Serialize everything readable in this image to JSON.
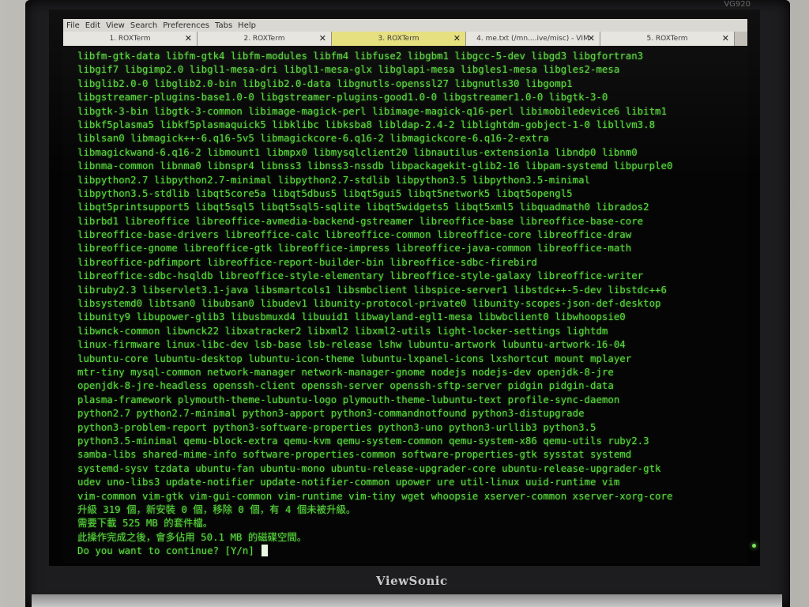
{
  "monitor": {
    "brand": "ViewSonic",
    "model": "VG920"
  },
  "menubar": [
    "File",
    "Edit",
    "View",
    "Search",
    "Preferences",
    "Tabs",
    "Help"
  ],
  "tabs": [
    {
      "label": "1. ROXTerm",
      "active": false
    },
    {
      "label": "2. ROXTerm",
      "active": false
    },
    {
      "label": "3. ROXTerm",
      "active": true
    },
    {
      "label": "4. me.txt (/mn....ive/misc) - VIM",
      "active": false
    },
    {
      "label": "5. ROXTerm",
      "active": false
    }
  ],
  "terminal": {
    "lines": [
      "libfm-gtk-data libfm-gtk4 libfm-modules libfm4 libfuse2 libgbm1 libgcc-5-dev libgd3 libgfortran3",
      "libgif7 libgimp2.0 libgl1-mesa-dri libgl1-mesa-glx libglapi-mesa libgles1-mesa libgles2-mesa",
      "libglib2.0-0 libglib2.0-bin libglib2.0-data libgnutls-openssl27 libgnutls30 libgomp1",
      "libgstreamer-plugins-base1.0-0 libgstreamer-plugins-good1.0-0 libgstreamer1.0-0 libgtk-3-0",
      "libgtk-3-bin libgtk-3-common libimage-magick-perl libimage-magick-q16-perl libimobiledevice6 libitm1",
      "libkf5plasma5 libkf5plasmaquick5 libklibc libksba8 libldap-2.4-2 liblightdm-gobject-1-0 libllvm3.8",
      "liblsan0 libmagick++-6.q16-5v5 libmagickcore-6.q16-2 libmagickcore-6.q16-2-extra",
      "libmagickwand-6.q16-2 libmount1 libmpx0 libmysqlclient20 libnautilus-extension1a libndp0 libnm0",
      "libnma-common libnma0 libnspr4 libnss3 libnss3-nssdb libpackagekit-glib2-16 libpam-systemd libpurple0",
      "libpython2.7 libpython2.7-minimal libpython2.7-stdlib libpython3.5 libpython3.5-minimal",
      "libpython3.5-stdlib libqt5core5a libqt5dbus5 libqt5gui5 libqt5network5 libqt5opengl5",
      "libqt5printsupport5 libqt5sql5 libqt5sql5-sqlite libqt5widgets5 libqt5xml5 libquadmath0 librados2",
      "librbd1 libreoffice libreoffice-avmedia-backend-gstreamer libreoffice-base libreoffice-base-core",
      "libreoffice-base-drivers libreoffice-calc libreoffice-common libreoffice-core libreoffice-draw",
      "libreoffice-gnome libreoffice-gtk libreoffice-impress libreoffice-java-common libreoffice-math",
      "libreoffice-pdfimport libreoffice-report-builder-bin libreoffice-sdbc-firebird",
      "libreoffice-sdbc-hsqldb libreoffice-style-elementary libreoffice-style-galaxy libreoffice-writer",
      "libruby2.3 libservlet3.1-java libsmartcols1 libsmbclient libspice-server1 libstdc++-5-dev libstdc++6",
      "libsystemd0 libtsan0 libubsan0 libudev1 libunity-protocol-private0 libunity-scopes-json-def-desktop",
      "libunity9 libupower-glib3 libusbmuxd4 libuuid1 libwayland-egl1-mesa libwbclient0 libwhoopsie0",
      "libwnck-common libwnck22 libxatracker2 libxml2 libxml2-utils light-locker-settings lightdm",
      "linux-firmware linux-libc-dev lsb-base lsb-release lshw lubuntu-artwork lubuntu-artwork-16-04",
      "lubuntu-core lubuntu-desktop lubuntu-icon-theme lubuntu-lxpanel-icons lxshortcut mount mplayer",
      "mtr-tiny mysql-common network-manager network-manager-gnome nodejs nodejs-dev openjdk-8-jre",
      "openjdk-8-jre-headless openssh-client openssh-server openssh-sftp-server pidgin pidgin-data",
      "plasma-framework plymouth-theme-lubuntu-logo plymouth-theme-lubuntu-text profile-sync-daemon",
      "python2.7 python2.7-minimal python3-apport python3-commandnotfound python3-distupgrade",
      "python3-problem-report python3-software-properties python3-uno python3-urllib3 python3.5",
      "python3.5-minimal qemu-block-extra qemu-kvm qemu-system-common qemu-system-x86 qemu-utils ruby2.3",
      "samba-libs shared-mime-info software-properties-common software-properties-gtk sysstat systemd",
      "systemd-sysv tzdata ubuntu-fan ubuntu-mono ubuntu-release-upgrader-core ubuntu-release-upgrader-gtk",
      "udev uno-libs3 update-notifier update-notifier-common upower ure util-linux uuid-runtime vim",
      "vim-common vim-gtk vim-gui-common vim-runtime vim-tiny wget whoopsie xserver-common xserver-xorg-core",
      "升級 319 個，新安裝 0 個，移除 0 個，有 4 個未被升級。",
      "需要下載 525 MB 的套件檔。",
      "此操作完成之後，會多佔用 50.1 MB 的磁碟空間。"
    ],
    "prompt": "Do you want to continue? [Y/n] "
  }
}
